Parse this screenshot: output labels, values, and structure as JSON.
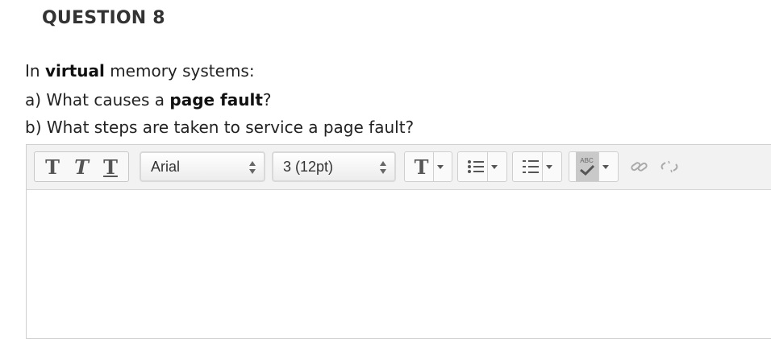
{
  "question": {
    "title": "QUESTION 8",
    "line1": {
      "pre": "In ",
      "bold": "virtual",
      "post": " memory systems:"
    },
    "line2": {
      "pre": "a) What causes a ",
      "bold": "page fault",
      "post": "?"
    },
    "line3": "b) What steps are taken to service a page fault?"
  },
  "toolbar": {
    "text_style_buttons": [
      "T",
      "T",
      "T"
    ],
    "font_family": "Arial",
    "font_size": "3 (12pt)",
    "text_color_glyph": "T",
    "spell_check_label": "ABC"
  }
}
